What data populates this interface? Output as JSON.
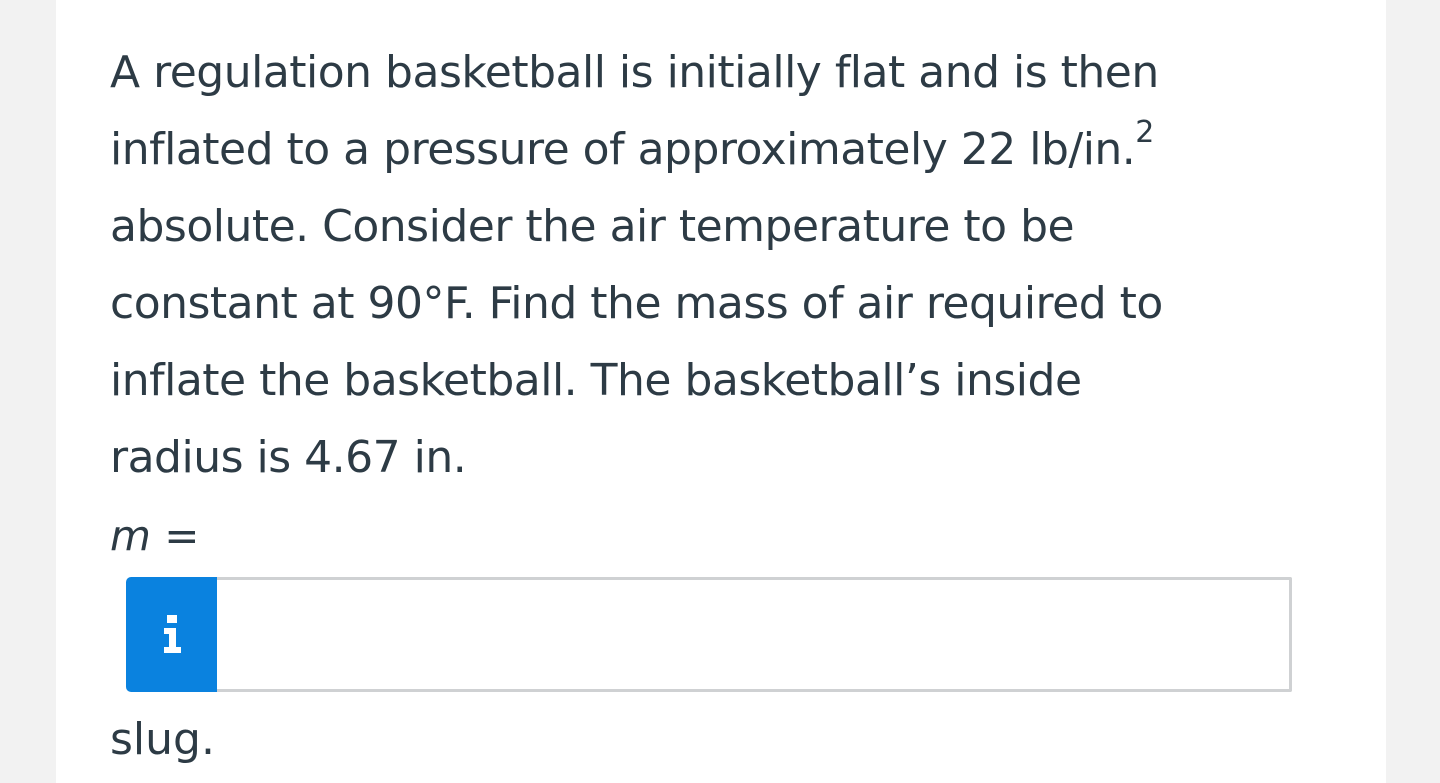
{
  "question": {
    "lines": [
      "A regulation basketball is initially flat and is then",
      "inflated to a pressure of approximately 22 lb/in.",
      "absolute. Consider the air temperature to be",
      "constant at 90°F. Find the mass of air required to",
      "inflate the basketball. The basketball’s inside",
      "radius is 4.67 in."
    ],
    "superscript": "2"
  },
  "answer": {
    "variable": "m",
    "equals": " =",
    "info_icon": "info-icon",
    "input_value": "",
    "input_placeholder": "",
    "unit": "slug."
  },
  "colors": {
    "text": "#2d3b45",
    "info_button": "#0a82df",
    "input_border": "#cfd1d3",
    "background": "#f2f2f2",
    "card": "#ffffff"
  }
}
